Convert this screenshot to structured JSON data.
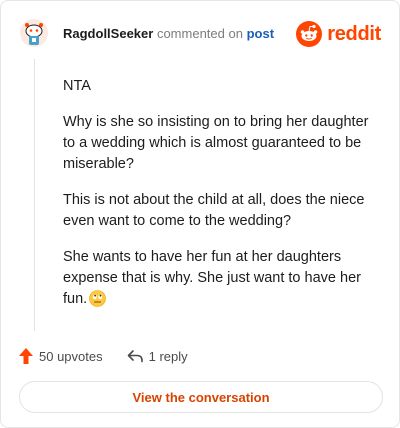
{
  "header": {
    "author": "RagdollSeeker",
    "commented_text": "commented on",
    "post_link": "post",
    "brand": "reddit",
    "accent_color": "#ff4500"
  },
  "comment": {
    "paragraphs": [
      "NTA",
      "Why is she so insisting on to bring her daughter to a wedding which is almost guaranteed to be miserable?",
      "This is not about the child at all, does the niece even want to come to the wedding?",
      "She wants to have her fun at her daughters expense that is why. She just want to have her fun."
    ],
    "emoji": "face-with-rolling-eyes-emoji"
  },
  "actions": {
    "upvotes": "50 upvotes",
    "replies": "1 reply"
  },
  "cta": {
    "label": "View the conversation"
  }
}
